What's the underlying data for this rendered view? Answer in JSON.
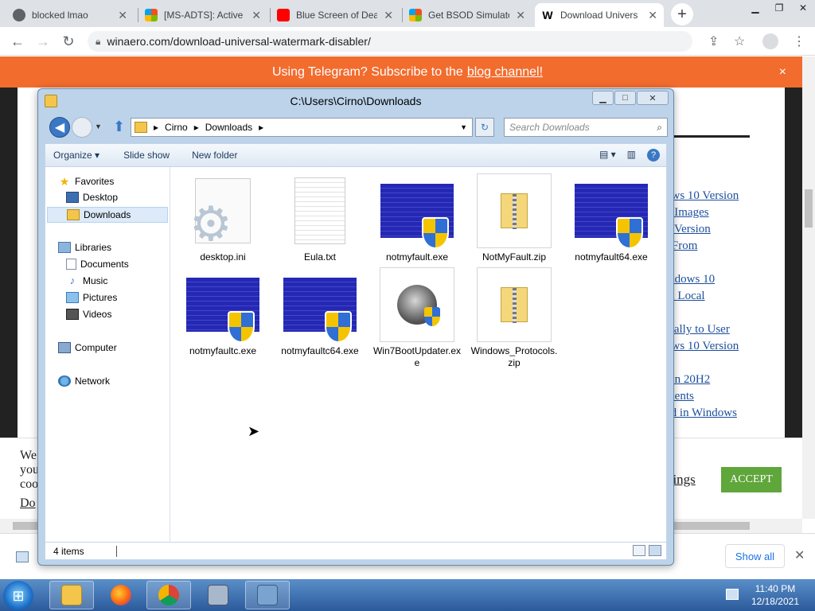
{
  "browser": {
    "tabs": [
      {
        "title": "blocked lmao",
        "icon": "chrome-icon"
      },
      {
        "title": "[MS-ADTS]: Active",
        "icon": "microsoft-icon"
      },
      {
        "title": "Blue Screen of Dea",
        "icon": "youtube-icon"
      },
      {
        "title": "Get BSOD Simulato",
        "icon": "microsoft-icon"
      },
      {
        "title": "Download Univers",
        "icon": "winaero-icon",
        "active": true
      }
    ],
    "new_tab": "+",
    "close_glyph": "✕",
    "url": "winaero.com/download-universal-watermark-disabler/"
  },
  "page": {
    "banner_text": "Using Telegram? Subscribe to the",
    "banner_link": "blog channel!",
    "banner_close": "×",
    "sidebar_heading": "s",
    "sidebar_links": [
      "ows 10 Version",
      "0 Images",
      "0 Version",
      "t From",
      "indows 10",
      "th Local",
      "ically to User",
      "ows 10 Version",
      "ion 20H2",
      "ments",
      "ed in Windows"
    ],
    "cookie_lines": [
      "We",
      "you",
      "coo",
      "Do"
    ],
    "cookie_settings": "ttings",
    "accept_label": "ACCEPT"
  },
  "downloads_bar": {
    "show_all": "Show all",
    "close": "✕"
  },
  "explorer": {
    "title": "C:\\Users\\Cirno\\Downloads",
    "address": {
      "segments": [
        "Cirno",
        "Downloads"
      ]
    },
    "search_placeholder": "Search Downloads",
    "commands": {
      "organize": "Organize ▾",
      "slideshow": "Slide show",
      "new_folder": "New folder"
    },
    "nav": {
      "favorites": "Favorites",
      "desktop": "Desktop",
      "downloads": "Downloads",
      "libraries": "Libraries",
      "documents": "Documents",
      "music": "Music",
      "pictures": "Pictures",
      "videos": "Videos",
      "computer": "Computer",
      "network": "Network"
    },
    "files": [
      {
        "name": "desktop.ini",
        "kind": "settings"
      },
      {
        "name": "Eula.txt",
        "kind": "text"
      },
      {
        "name": "notmyfault.exe",
        "kind": "bsod"
      },
      {
        "name": "NotMyFault.zip",
        "kind": "zip"
      },
      {
        "name": "notmyfault64.exe",
        "kind": "bsod"
      },
      {
        "name": "notmyfaultc.exe",
        "kind": "bsod"
      },
      {
        "name": "notmyfaultc64.exe",
        "kind": "bsod"
      },
      {
        "name": "Win7BootUpdater.exe",
        "kind": "app"
      },
      {
        "name": "Windows_Protocols.zip",
        "kind": "zip"
      }
    ],
    "status": "4 items"
  },
  "taskbar": {
    "time": "11:40 PM",
    "date": "12/18/2021"
  }
}
